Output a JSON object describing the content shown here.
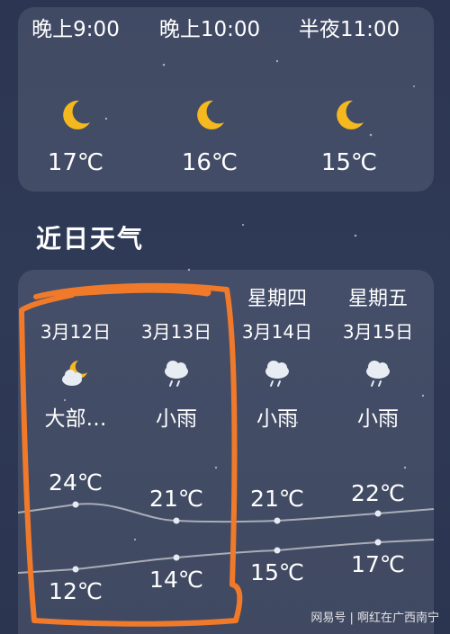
{
  "hourly": [
    {
      "time": "晚上9:00",
      "icon": "moon-icon",
      "temp": "17℃"
    },
    {
      "time": "晚上10:00",
      "icon": "moon-icon",
      "temp": "16℃"
    },
    {
      "time": "半夜11:00",
      "icon": "moon-icon",
      "temp": "15℃"
    }
  ],
  "section_title": "近日天气",
  "daily": [
    {
      "weekday": "",
      "date": "3月12日",
      "icon": "partly-cloudy-night-icon",
      "condition": "大部…",
      "high": "24℃",
      "low": "12℃"
    },
    {
      "weekday": "",
      "date": "3月13日",
      "icon": "light-rain-icon",
      "condition": "小雨",
      "high": "21℃",
      "low": "14℃"
    },
    {
      "weekday": "星期四",
      "date": "3月14日",
      "icon": "light-rain-icon",
      "condition": "小雨",
      "high": "21℃",
      "low": "15℃"
    },
    {
      "weekday": "星期五",
      "date": "3月15日",
      "icon": "light-rain-icon",
      "condition": "小雨",
      "high": "22℃",
      "low": "17℃"
    }
  ],
  "footer": "网易号 | 啊红在广西南宁",
  "colors": {
    "accent": "#f5b91f",
    "highlight": "#f07a2a"
  }
}
